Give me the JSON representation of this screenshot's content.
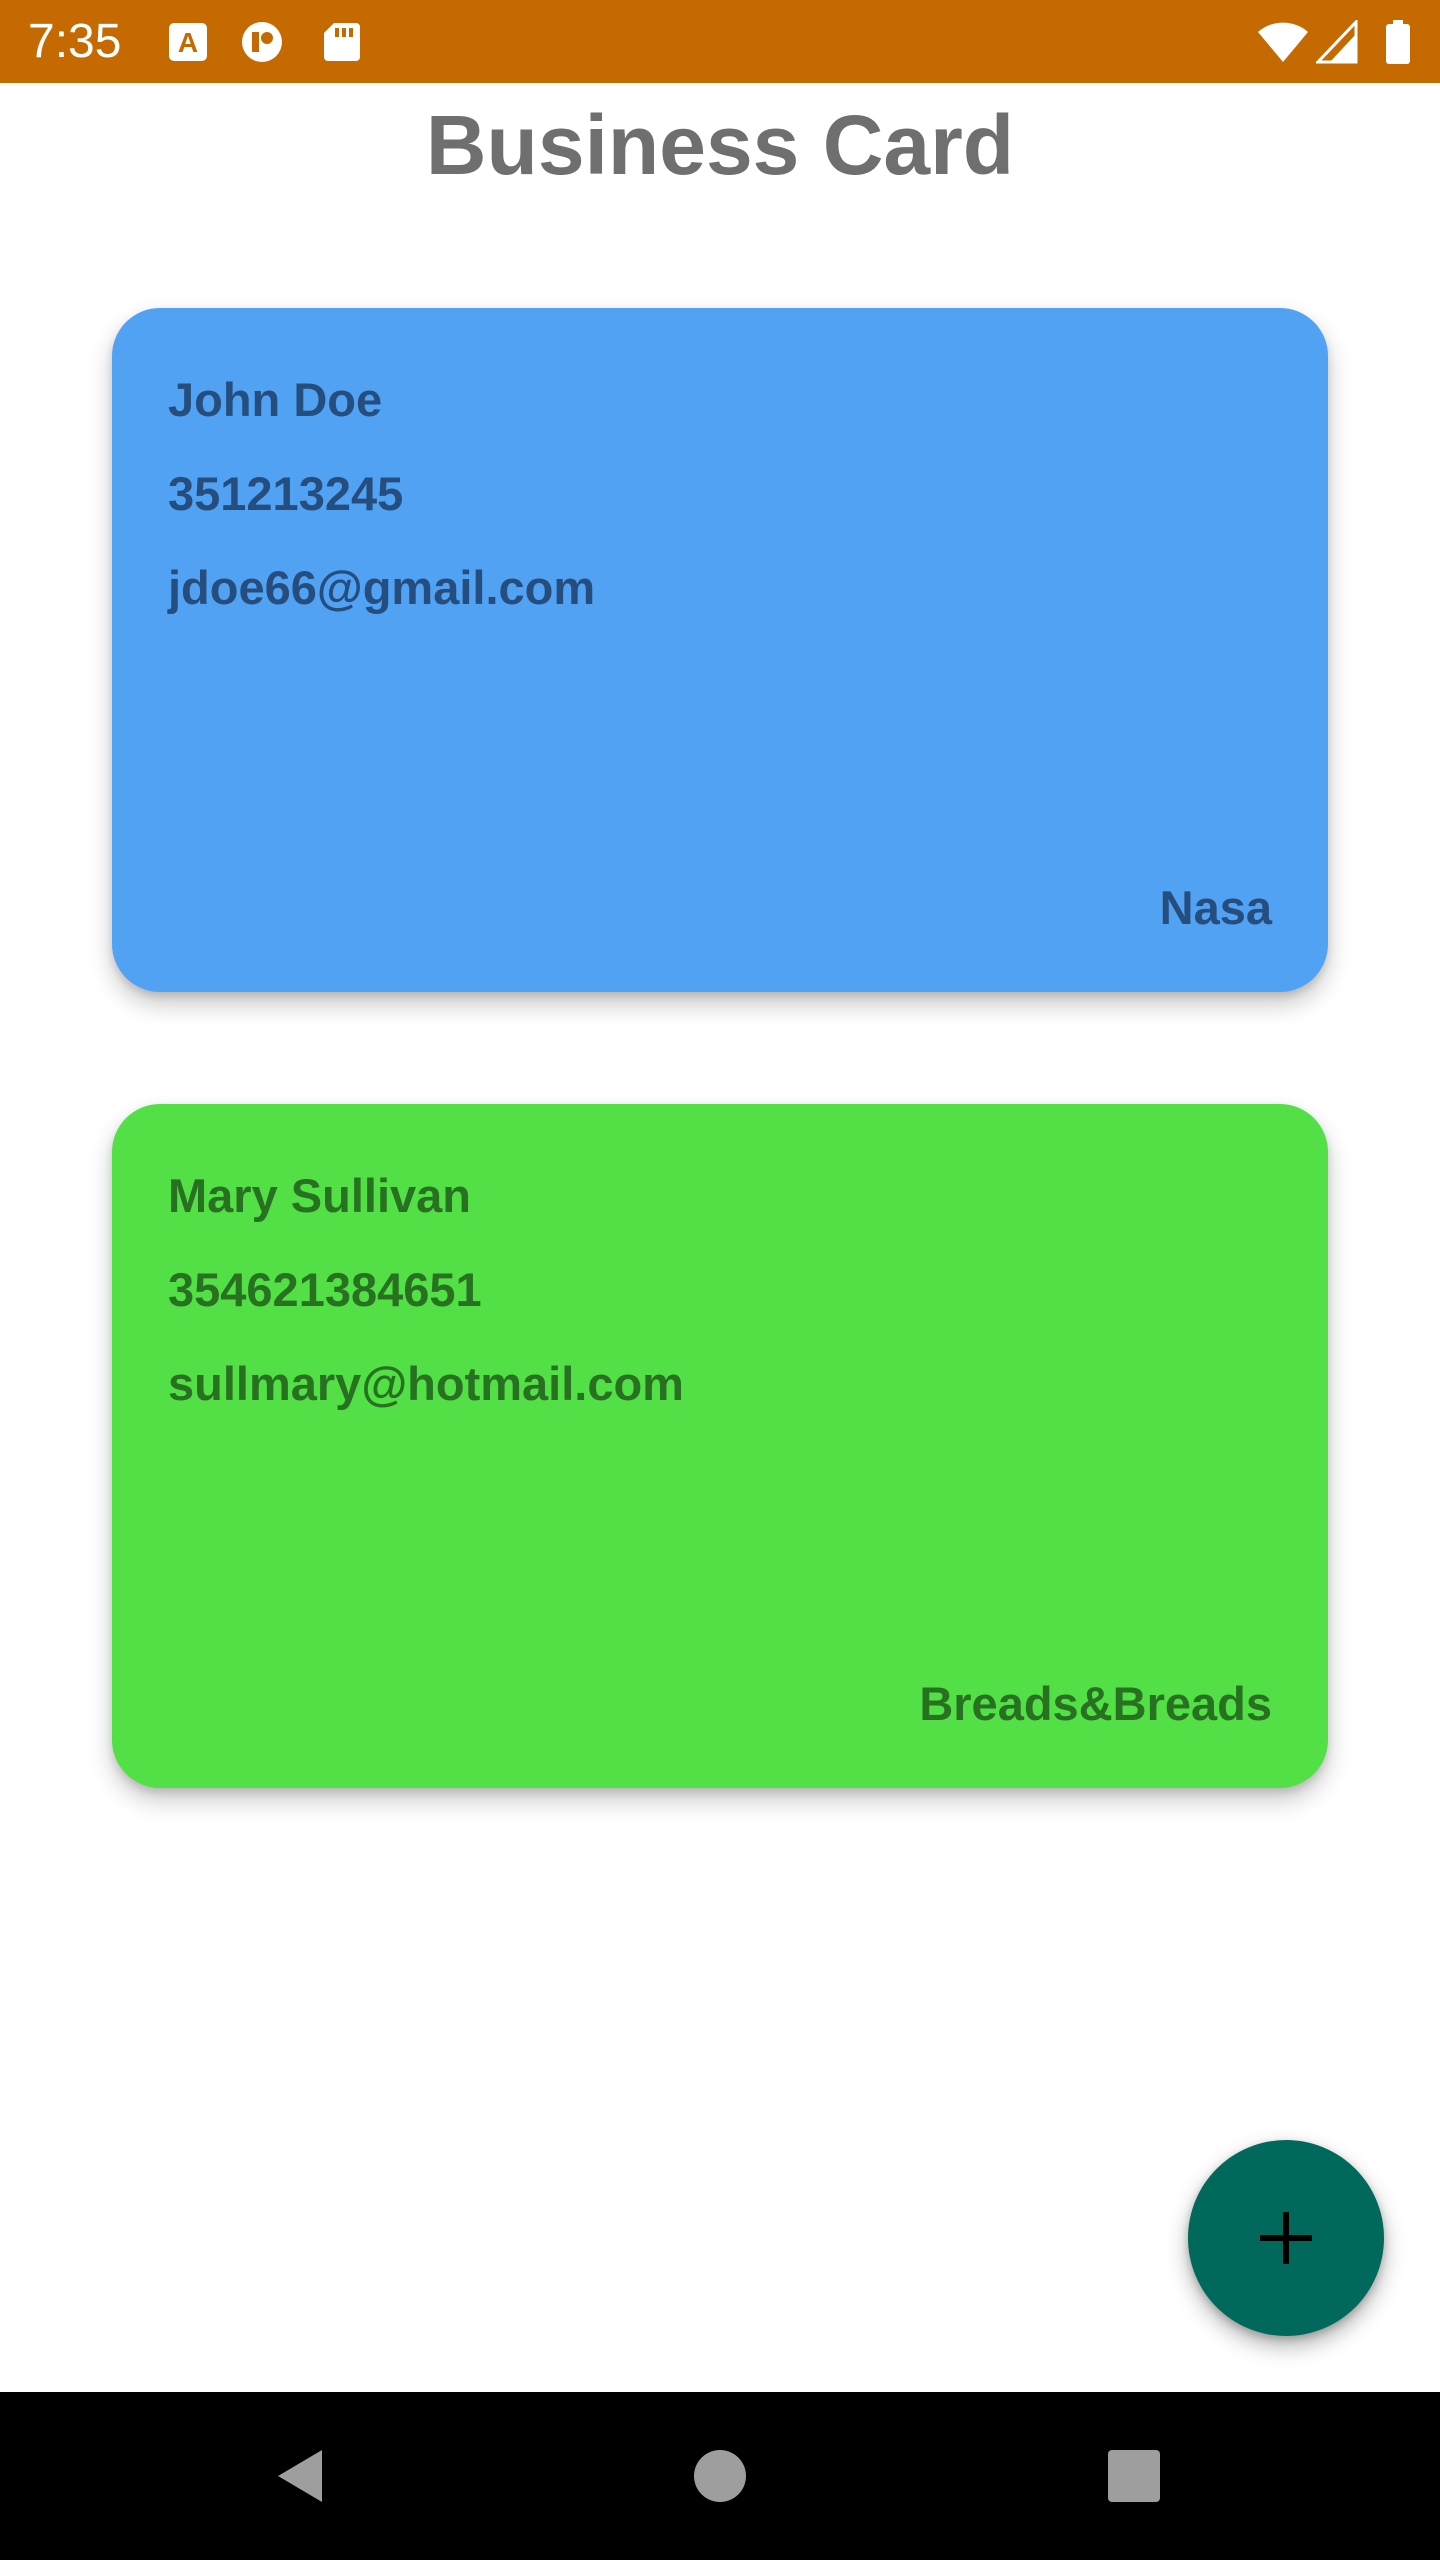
{
  "status_bar": {
    "time": "7:35",
    "background": "#c56a00",
    "icons": [
      "font-a-icon",
      "circle-app-icon",
      "sd-card-icon",
      "wifi-icon",
      "cell-signal-icon",
      "battery-icon"
    ]
  },
  "page": {
    "title": "Business Card"
  },
  "cards": [
    {
      "name": "John Doe",
      "phone": "351213245",
      "email": "jdoe66@gmail.com",
      "company": "Nasa",
      "background": "#52a2f4",
      "text_color": "#254e7e"
    },
    {
      "name": "Mary Sullivan",
      "phone": "354621384651",
      "email": "sullmary@hotmail.com",
      "company": "Breads&Breads",
      "background": "#53e047",
      "text_color": "#277121"
    }
  ],
  "fab": {
    "icon": "plus-icon",
    "background": "#00695c"
  },
  "nav_bar": {
    "icons": [
      "back-icon",
      "home-icon",
      "recents-icon"
    ]
  }
}
